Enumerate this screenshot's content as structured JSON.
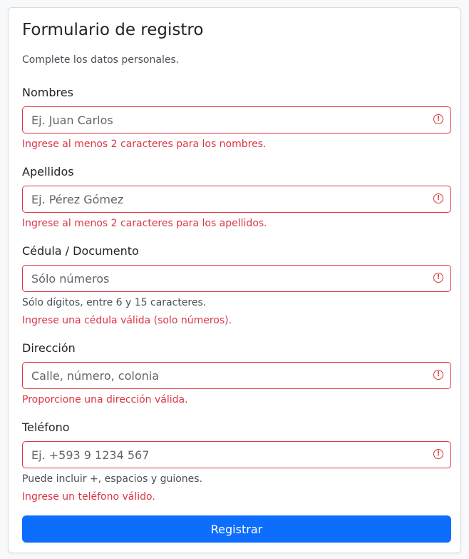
{
  "form": {
    "title": "Formulario de registro",
    "subtitle": "Complete los datos personales.",
    "submit_label": "Registrar",
    "error_icon": "exclamation-circle-icon",
    "fields": {
      "nombres": {
        "label": "Nombres",
        "placeholder": "Ej. Juan Carlos",
        "value": "",
        "error": "Ingrese al menos 2 caracteres para los nombres."
      },
      "apellidos": {
        "label": "Apellidos",
        "placeholder": "Ej. Pérez Gómez",
        "value": "",
        "error": "Ingrese al menos 2 caracteres para los apellidos."
      },
      "cedula": {
        "label": "Cédula / Documento",
        "placeholder": "Sólo números",
        "value": "",
        "help": "Sólo dígitos, entre 6 y 15 caracteres.",
        "error": "Ingrese una cédula válida (solo números)."
      },
      "direccion": {
        "label": "Dirección",
        "placeholder": "Calle, número, colonia",
        "value": "",
        "error": "Proporcione una dirección válida."
      },
      "telefono": {
        "label": "Teléfono",
        "placeholder": "Ej. +593 9 1234 567",
        "value": "",
        "help": "Puede incluir +, espacios y guiones.",
        "error": "Ingrese un teléfono válido."
      }
    }
  },
  "colors": {
    "primary": "#0d6efd",
    "danger": "#dc3545",
    "muted": "#495057"
  }
}
